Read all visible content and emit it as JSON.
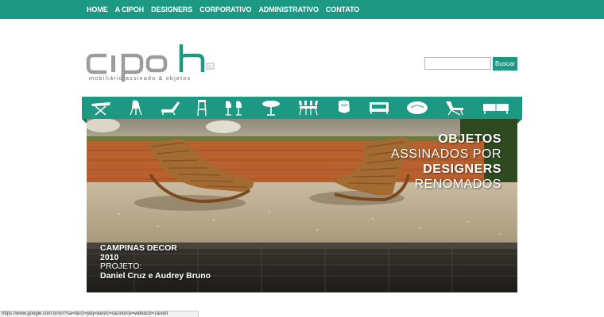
{
  "nav": {
    "items": [
      "HOME",
      "A CIPOH",
      "DESIGNERS",
      "CORPORATIVO",
      "ADMINISTRATIVO",
      "CONTATO"
    ]
  },
  "logo": {
    "wordmark": "cipoh",
    "tagline": "mobiliário assinado & objetos"
  },
  "search": {
    "value": "",
    "button_label": "Buscar"
  },
  "categories": [
    {
      "icon": "ironing-table-icon"
    },
    {
      "icon": "shell-chair-icon"
    },
    {
      "icon": "lounge-chair-icon"
    },
    {
      "icon": "bar-stool-icon"
    },
    {
      "icon": "chairs-pair-icon"
    },
    {
      "icon": "round-table-icon"
    },
    {
      "icon": "dining-set-icon"
    },
    {
      "icon": "armchair-icon"
    },
    {
      "icon": "sofa-icon"
    },
    {
      "icon": "ottoman-icon"
    },
    {
      "icon": "recliner-icon"
    },
    {
      "icon": "sideboard-icon"
    }
  ],
  "hero": {
    "headline": [
      "OBJETOS",
      "ASSINADOS POR",
      "DESIGNERS",
      "RENOMADOS"
    ],
    "caption": {
      "event": "CAMPINAS DECOR",
      "year": "2010",
      "project_label": "PROJETO:",
      "designers": "Daniel Cruz e Audrey Bruno"
    }
  },
  "status_bar": {
    "url": "https://www.google.com.br/url?sa=t&rct=j&q=&esrc=s&source=web&cd=1&ved"
  },
  "colors": {
    "brand": "#1d9883",
    "text_gray": "#6c6c6c"
  }
}
